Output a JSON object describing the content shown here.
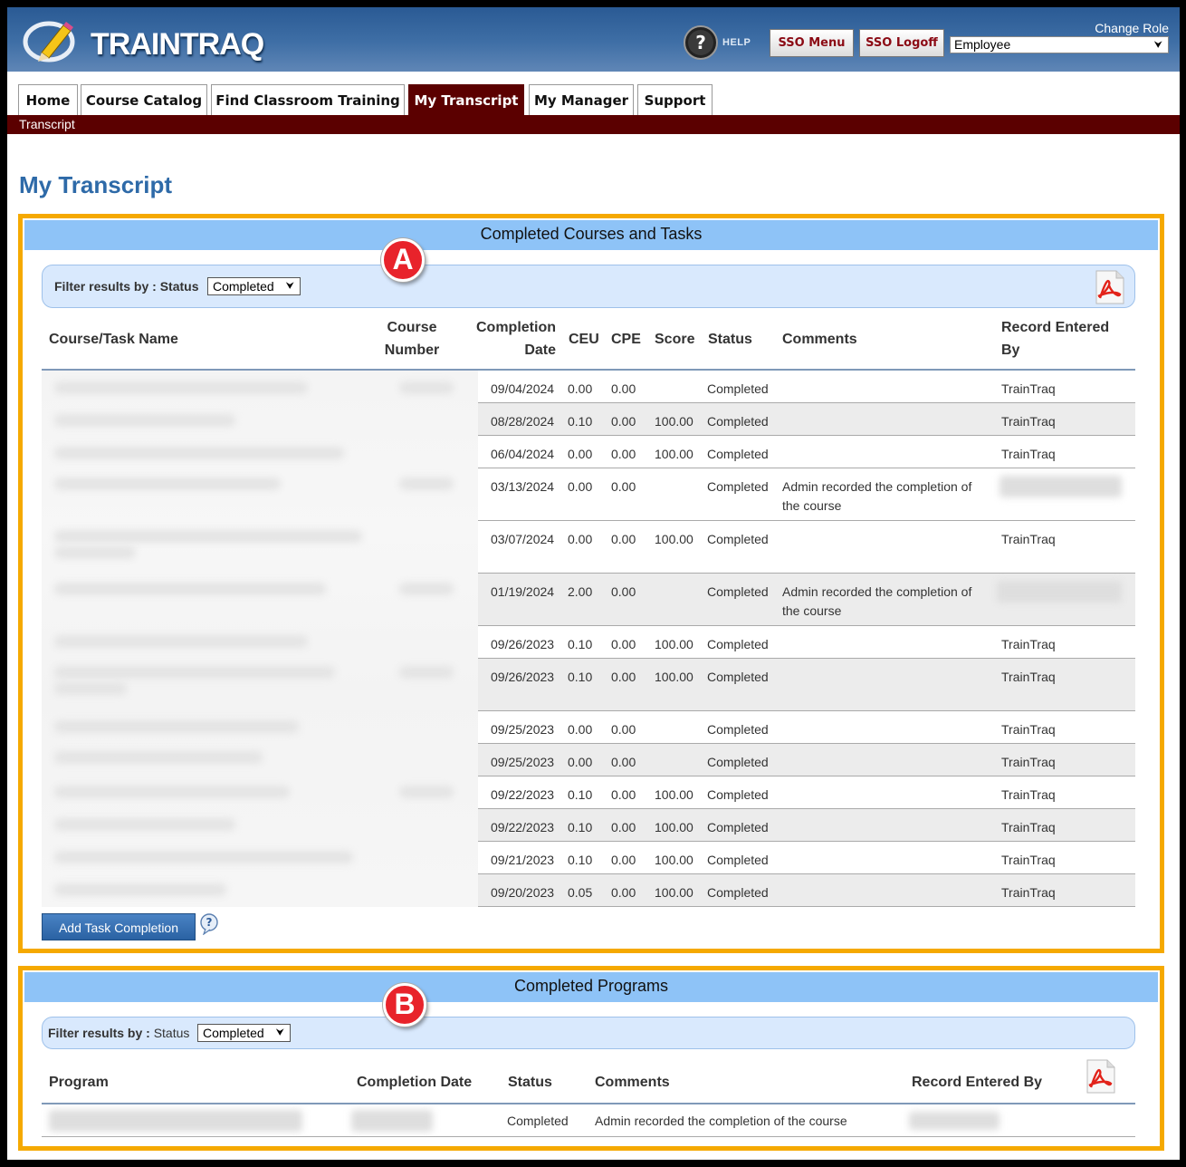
{
  "header": {
    "logo_text": "TRAINTRAQ",
    "help_label": "HELP",
    "sso_menu_label": "SSO Menu",
    "sso_logoff_label": "SSO Logoff",
    "change_role_label": "Change Role",
    "role_selected": "Employee"
  },
  "tabs": [
    {
      "label": "Home",
      "active": false
    },
    {
      "label": "Course Catalog",
      "active": false
    },
    {
      "label": "Find Classroom Training",
      "active": false
    },
    {
      "label": "My Transcript",
      "active": true
    },
    {
      "label": "My Manager",
      "active": false
    },
    {
      "label": "Support",
      "active": false
    }
  ],
  "breadcrumb": "Transcript",
  "page_title": "My Transcript",
  "markers": {
    "a": "A",
    "b": "B"
  },
  "completed_courses": {
    "title": "Completed Courses and Tasks",
    "filter_label": "Filter results by : Status",
    "filter_value": "Completed",
    "columns": {
      "name": "Course/Task Name",
      "number_1": "Course",
      "number_2": "Number",
      "date_1": "Completion",
      "date_2": "Date",
      "ceu": "CEU",
      "cpe": "CPE",
      "score": "Score",
      "status": "Status",
      "comments": "Comments",
      "entered_1": "Record Entered",
      "entered_2": "By"
    },
    "rows": [
      {
        "date": "09/04/2024",
        "ceu": "0.00",
        "cpe": "0.00",
        "score": "",
        "status": "Completed",
        "comments": "",
        "entered": "TrainTraq"
      },
      {
        "date": "08/28/2024",
        "ceu": "0.10",
        "cpe": "0.00",
        "score": "100.00",
        "status": "Completed",
        "comments": "",
        "entered": "TrainTraq"
      },
      {
        "date": "06/04/2024",
        "ceu": "0.00",
        "cpe": "0.00",
        "score": "100.00",
        "status": "Completed",
        "comments": "",
        "entered": "TrainTraq"
      },
      {
        "date": "03/13/2024",
        "ceu": "0.00",
        "cpe": "0.00",
        "score": "",
        "status": "Completed",
        "comments": "Admin recorded the completion of the course",
        "entered": ""
      },
      {
        "date": "03/07/2024",
        "ceu": "0.00",
        "cpe": "0.00",
        "score": "100.00",
        "status": "Completed",
        "comments": "",
        "entered": "TrainTraq"
      },
      {
        "date": "01/19/2024",
        "ceu": "2.00",
        "cpe": "0.00",
        "score": "",
        "status": "Completed",
        "comments": "Admin recorded the completion of the course",
        "entered": ""
      },
      {
        "date": "09/26/2023",
        "ceu": "0.10",
        "cpe": "0.00",
        "score": "100.00",
        "status": "Completed",
        "comments": "",
        "entered": "TrainTraq"
      },
      {
        "date": "09/26/2023",
        "ceu": "0.10",
        "cpe": "0.00",
        "score": "100.00",
        "status": "Completed",
        "comments": "",
        "entered": "TrainTraq"
      },
      {
        "date": "09/25/2023",
        "ceu": "0.00",
        "cpe": "0.00",
        "score": "",
        "status": "Completed",
        "comments": "",
        "entered": "TrainTraq"
      },
      {
        "date": "09/25/2023",
        "ceu": "0.00",
        "cpe": "0.00",
        "score": "",
        "status": "Completed",
        "comments": "",
        "entered": "TrainTraq"
      },
      {
        "date": "09/22/2023",
        "ceu": "0.10",
        "cpe": "0.00",
        "score": "100.00",
        "status": "Completed",
        "comments": "",
        "entered": "TrainTraq"
      },
      {
        "date": "09/22/2023",
        "ceu": "0.10",
        "cpe": "0.00",
        "score": "100.00",
        "status": "Completed",
        "comments": "",
        "entered": "TrainTraq"
      },
      {
        "date": "09/21/2023",
        "ceu": "0.10",
        "cpe": "0.00",
        "score": "100.00",
        "status": "Completed",
        "comments": "",
        "entered": "TrainTraq"
      },
      {
        "date": "09/20/2023",
        "ceu": "0.05",
        "cpe": "0.00",
        "score": "100.00",
        "status": "Completed",
        "comments": "",
        "entered": "TrainTraq"
      }
    ],
    "add_task_label": "Add Task Completion"
  },
  "completed_programs": {
    "title": "Completed Programs",
    "filter_label_bold": "Filter results by :",
    "filter_label_rest": "Status",
    "filter_value": "Completed",
    "columns": {
      "program": "Program",
      "date": "Completion Date",
      "status": "Status",
      "comments": "Comments",
      "entered": "Record Entered By"
    },
    "rows": [
      {
        "status": "Completed",
        "comments": "Admin recorded the completion of the course"
      }
    ]
  },
  "colors": {
    "header_blue": "#3f6fa6",
    "tab_active": "#5b0000",
    "title_blue": "#2e6aa8",
    "panel_border": "#f5a900",
    "panel_head": "#8ec3f7",
    "marker_red": "#e8232b"
  }
}
